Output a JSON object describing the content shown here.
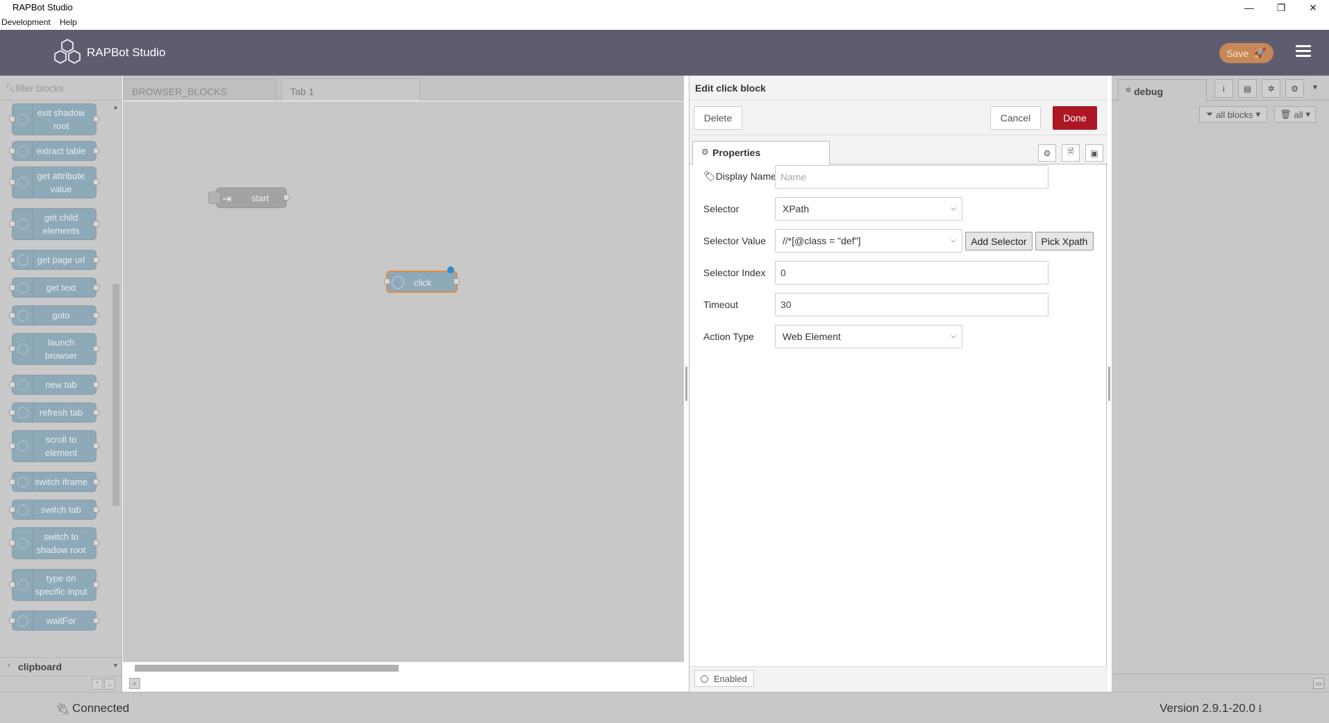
{
  "window": {
    "title": "RAPBot Studio",
    "menus": [
      "Development",
      "Help"
    ],
    "controls": {
      "minimize": "—",
      "restore": "❐",
      "close": "✕"
    }
  },
  "header": {
    "app_name": "RAPBot Studio",
    "save_label": "Save",
    "colors": {
      "header_bg": "#605c70",
      "save_bg": "#c68856"
    }
  },
  "palette": {
    "filter_placeholder": "filter blocks",
    "nodes": [
      {
        "label": "exit shadow root"
      },
      {
        "label": "extract table"
      },
      {
        "label": "get attribute value"
      },
      {
        "label": "get child elements"
      },
      {
        "label": "get page url"
      },
      {
        "label": "get text"
      },
      {
        "label": "goto"
      },
      {
        "label": "launch browser"
      },
      {
        "label": "new tab"
      },
      {
        "label": "refresh tab"
      },
      {
        "label": "scroll to element"
      },
      {
        "label": "switch iframe"
      },
      {
        "label": "switch tab"
      },
      {
        "label": "switch to shadow root"
      },
      {
        "label": "type on specific input"
      },
      {
        "label": "waitFor"
      }
    ],
    "category": "clipboard"
  },
  "workspace": {
    "tabs": [
      {
        "label": "BROWSER_BLOCKS",
        "active": false
      },
      {
        "label": "Tab 1",
        "active": true
      }
    ],
    "flow_nodes": [
      {
        "label": "start",
        "type": "start"
      },
      {
        "label": "click",
        "type": "browser",
        "selected": true
      }
    ]
  },
  "editor": {
    "title": "Edit click block",
    "delete_label": "Delete",
    "cancel_label": "Cancel",
    "done_label": "Done",
    "properties_tab": "Properties",
    "fields": {
      "display_name": {
        "label": "Display Name",
        "placeholder": "Name",
        "value": ""
      },
      "selector": {
        "label": "Selector",
        "value": "XPath"
      },
      "selector_value": {
        "label": "Selector Value",
        "value": "//*[@class = \"def\"]"
      },
      "selector_index": {
        "label": "Selector Index",
        "value": "0"
      },
      "timeout": {
        "label": "Timeout",
        "value": "30"
      },
      "action_type": {
        "label": "Action Type",
        "value": "Web Element"
      }
    },
    "add_selector_label": "Add Selector",
    "pick_xpath_label": "Pick Xpath",
    "enabled_label": "Enabled",
    "colors": {
      "done_bg": "#ad1625"
    }
  },
  "sidebar": {
    "tab_label": "debug",
    "filter_nodes_label": "all blocks",
    "clear_label": "all"
  },
  "status": {
    "connection": "Connected",
    "version": "Version 2.9.1-20.0"
  }
}
